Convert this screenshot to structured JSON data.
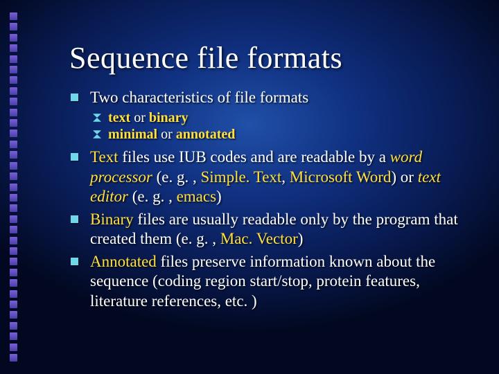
{
  "title": "Sequence file formats",
  "bullets": {
    "b1_lead": "Two characteristics of file formats",
    "sub1_a": "text",
    "sub1_mid": " or ",
    "sub1_b": "binary",
    "sub2_a": "minimal",
    "sub2_mid": " or ",
    "sub2_b": "annotated",
    "b2_a": "Text",
    "b2_b": " files use IUB codes and are readable by a ",
    "b2_c": "word processor",
    "b2_d": " (e. g. , ",
    "b2_e": "Simple. Text",
    "b2_f": ", ",
    "b2_g": "Microsoft Word",
    "b2_h": ") or ",
    "b2_i": "text editor",
    "b2_j": " (e. g. , ",
    "b2_k": "emacs",
    "b2_l": ")",
    "b3_a": "Binary",
    "b3_b": " files are usually readable only by the program that created them (e. g. , ",
    "b3_c": "Mac. Vector",
    "b3_d": ")",
    "b4_a": "Annotated",
    "b4_b": " files preserve information known about the sequence (coding region start/stop, protein features, literature references, etc. )"
  }
}
